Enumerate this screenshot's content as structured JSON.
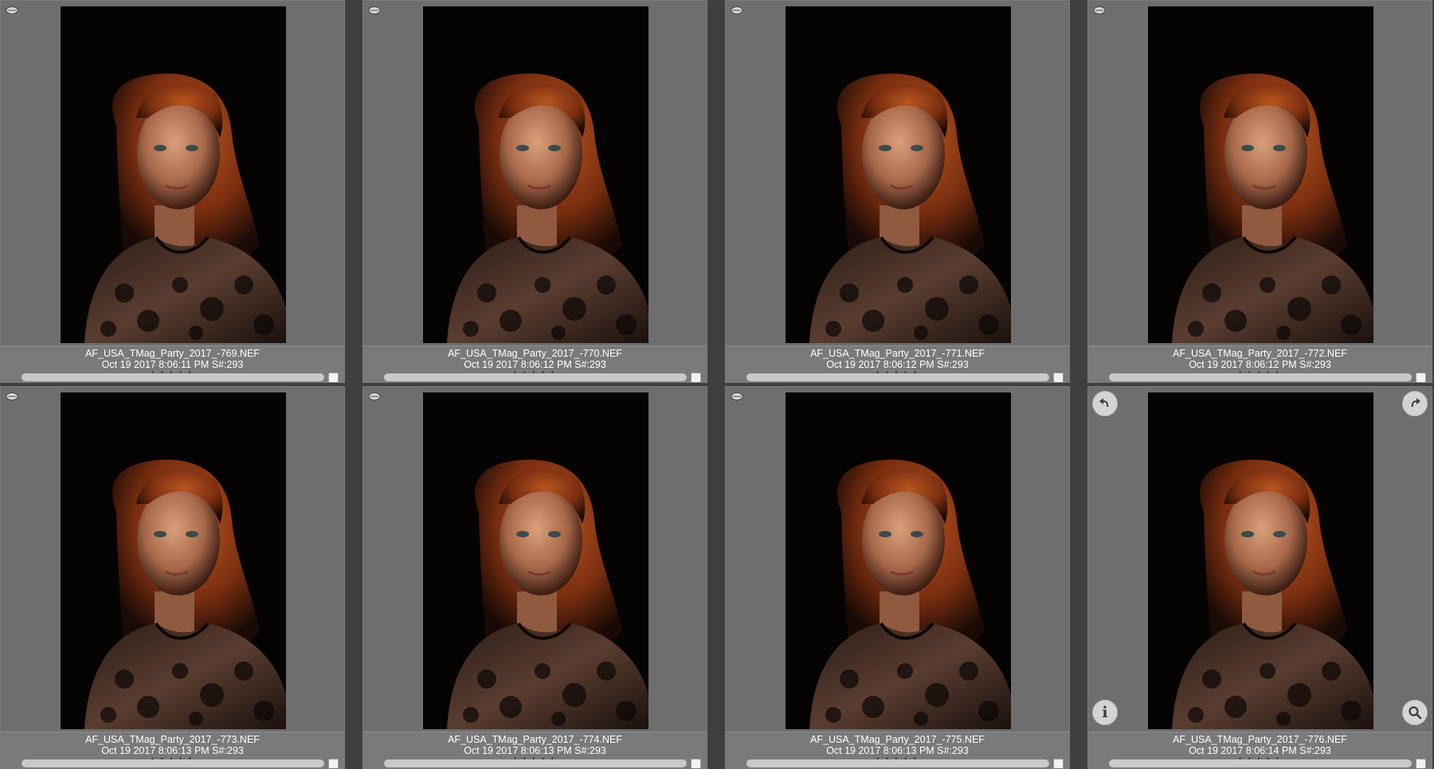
{
  "thumbnails": [
    {
      "filename": "AF_USA_TMag_Party_2017_-769.NEF",
      "meta": "Oct 19 2017 8:06:11 PM S#:293"
    },
    {
      "filename": "AF_USA_TMag_Party_2017_-770.NEF",
      "meta": "Oct 19 2017 8:06:12 PM S#:293"
    },
    {
      "filename": "AF_USA_TMag_Party_2017_-771.NEF",
      "meta": "Oct 19 2017 8:06:12 PM S#:293"
    },
    {
      "filename": "AF_USA_TMag_Party_2017_-772.NEF",
      "meta": "Oct 19 2017 8:06:12 PM S#:293"
    },
    {
      "filename": "AF_USA_TMag_Party_2017_-773.NEF",
      "meta": "Oct 19 2017 8:06:13 PM S#:293"
    },
    {
      "filename": "AF_USA_TMag_Party_2017_-774.NEF",
      "meta": "Oct 19 2017 8:06:13 PM S#:293"
    },
    {
      "filename": "AF_USA_TMag_Party_2017_-775.NEF",
      "meta": "Oct 19 2017 8:06:13 PM S#:293"
    },
    {
      "filename": "AF_USA_TMag_Party_2017_-776.NEF",
      "meta": "Oct 19 2017 8:06:14 PM S#:293"
    }
  ],
  "rating_dots": "• • • • •",
  "hover_controls": {
    "rotate_left_icon": "rotate-left-icon",
    "rotate_right_icon": "rotate-right-icon",
    "info_icon": "info-icon",
    "zoom_icon": "magnifier-icon",
    "info_glyph": "i"
  },
  "colors": {
    "panel": "#6e6e6e",
    "caption": "#7a7a7a",
    "background": "#3f3f3f"
  }
}
